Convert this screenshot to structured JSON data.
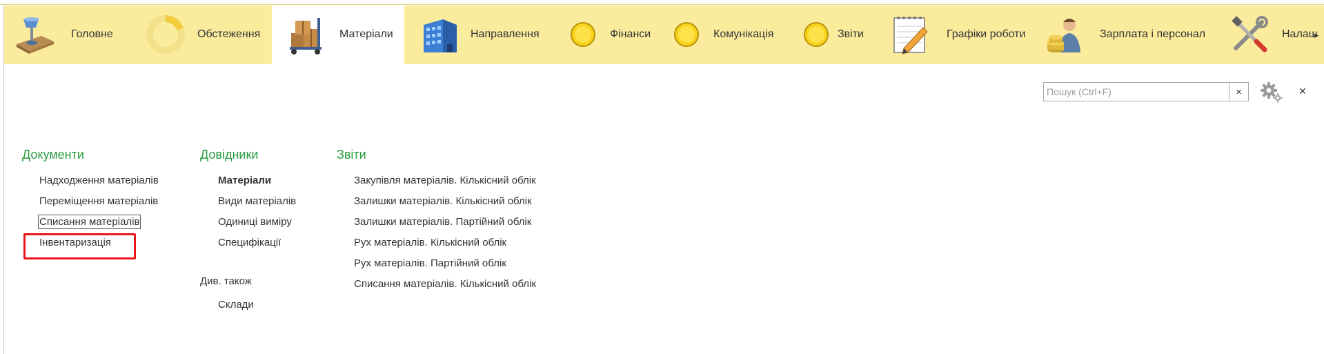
{
  "sections": [
    {
      "label": "Головне",
      "icon": "desk-lamp-icon"
    },
    {
      "label": "Обстеження",
      "icon": "loading-ring-icon"
    },
    {
      "label": "Матеріали",
      "icon": "boxes-cart-icon"
    },
    {
      "label": "Направлення",
      "icon": "building-icon"
    },
    {
      "label": "Фінанси",
      "icon": "yellow-circle-icon"
    },
    {
      "label": "Комунікація",
      "icon": "yellow-circle-icon"
    },
    {
      "label": "Звіти",
      "icon": "yellow-circle-icon"
    },
    {
      "label": "Графіки роботи",
      "icon": "notepad-pencil-icon"
    },
    {
      "label": "Зарплата і персонал",
      "icon": "worker-coins-icon"
    },
    {
      "label": "Налаш",
      "icon": "tools-icon"
    }
  ],
  "active_section": "Матеріали",
  "search": {
    "placeholder": "Пошук (Ctrl+F)",
    "value": "",
    "clear_label": "×"
  },
  "close_label": "×",
  "scroll_right_label": "▸",
  "columns": {
    "documents": {
      "title": "Документи",
      "items": [
        "Надходження матеріалів",
        "Переміщення матеріалів",
        "Списання матеріалів",
        "Інвентаризація"
      ]
    },
    "catalogs": {
      "title": "Довідники",
      "items": [
        "Матеріали",
        "Види матеріалів",
        "Одиниці виміру",
        "Специфікації"
      ],
      "see_also_title": "Див. також",
      "see_also_items": [
        "Склади"
      ]
    },
    "reports": {
      "title": "Звіти",
      "items": [
        "Закупівля матеріалів. Кількісний облік",
        "Залишки матеріалів. Кількісний облік",
        "Залишки матеріалів. Партійний облік",
        "Рух матеріалів. Кількісний облік",
        "Рух матеріалів. Партійний облік",
        "Списання матеріалів. Кількісний облік"
      ]
    }
  },
  "colors": {
    "panel_bg": "#fbec9d",
    "heading_green": "#2a9d3f",
    "highlight_red": "#e8141c"
  }
}
